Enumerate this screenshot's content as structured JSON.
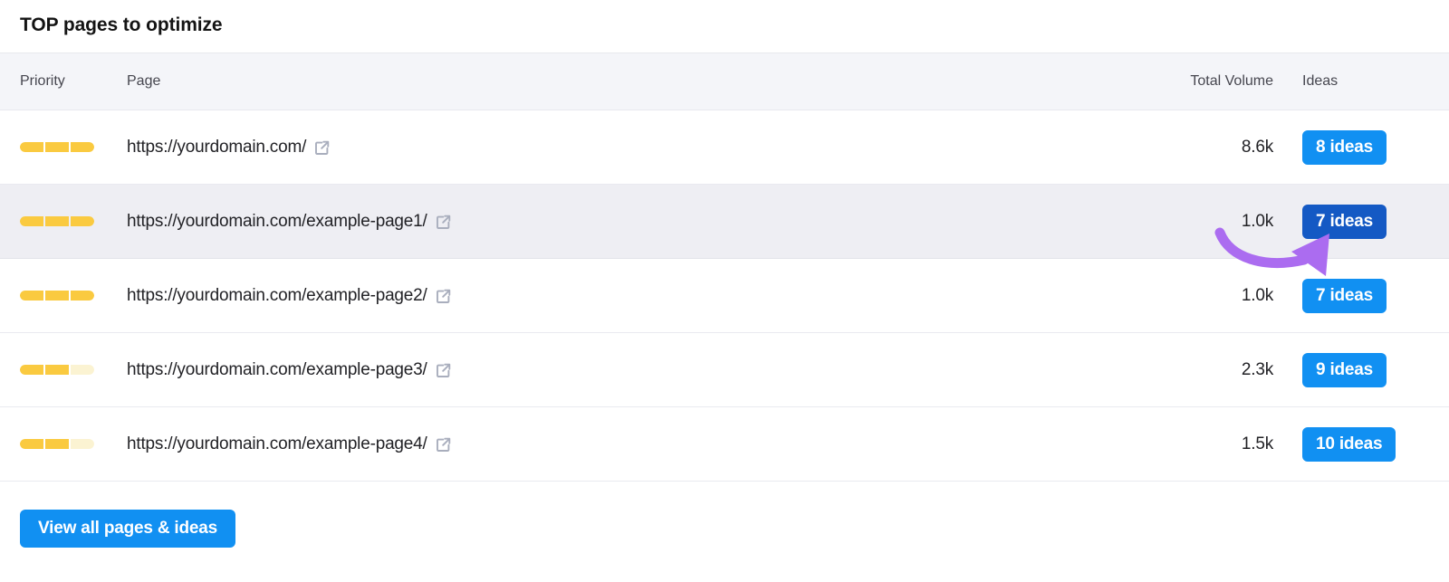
{
  "widget": {
    "title": "TOP pages to optimize"
  },
  "table": {
    "columns": {
      "priority": "Priority",
      "page": "Page",
      "total_volume": "Total Volume",
      "ideas": "Ideas"
    },
    "rows": [
      {
        "priority_filled": 3,
        "priority_total": 3,
        "url": "https://yourdomain.com/",
        "external_link_icon": "external-link-icon",
        "total_volume": "8.6k",
        "ideas_label": "8 ideas",
        "highlighted": false,
        "ideas_hovered": false
      },
      {
        "priority_filled": 3,
        "priority_total": 3,
        "url": "https://yourdomain.com/example-page1/",
        "external_link_icon": "external-link-icon",
        "total_volume": "1.0k",
        "ideas_label": "7 ideas",
        "highlighted": true,
        "ideas_hovered": true
      },
      {
        "priority_filled": 3,
        "priority_total": 3,
        "url": "https://yourdomain.com/example-page2/",
        "external_link_icon": "external-link-icon",
        "total_volume": "1.0k",
        "ideas_label": "7 ideas",
        "highlighted": false,
        "ideas_hovered": false
      },
      {
        "priority_filled": 2,
        "priority_total": 3,
        "url": "https://yourdomain.com/example-page3/",
        "external_link_icon": "external-link-icon",
        "total_volume": "2.3k",
        "ideas_label": "9 ideas",
        "highlighted": false,
        "ideas_hovered": false
      },
      {
        "priority_filled": 2,
        "priority_total": 3,
        "url": "https://yourdomain.com/example-page4/",
        "external_link_icon": "external-link-icon",
        "total_volume": "1.5k",
        "ideas_label": "10 ideas",
        "highlighted": false,
        "ideas_hovered": false
      }
    ]
  },
  "footer": {
    "view_all_label": "View all pages & ideas"
  },
  "annotation": {
    "type": "curved-arrow",
    "color": "#ab6cf0",
    "points_to": "7 ideas"
  },
  "colors": {
    "accent_blue": "#1190f2",
    "accent_blue_hover": "#1459c4",
    "priority_filled": "#faca40",
    "priority_empty": "#fbf3d2",
    "header_bg": "#f4f5f9",
    "row_highlight_bg": "#eeeef3",
    "annotation_purple": "#ab6cf0"
  }
}
